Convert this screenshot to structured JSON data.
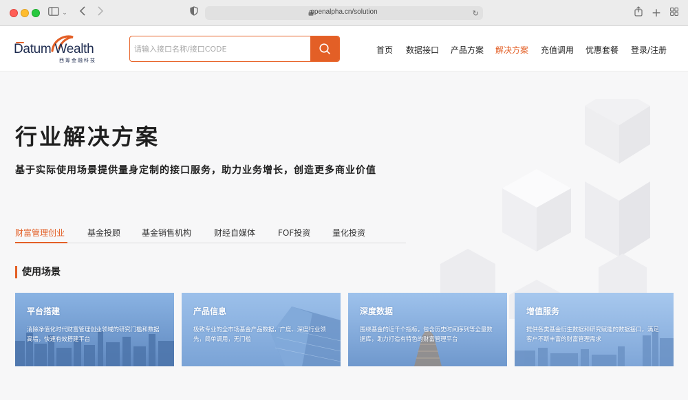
{
  "browser": {
    "url": "openalpha.cn/solution"
  },
  "site": {
    "logo": {
      "word": "Datum Wealth",
      "sub": "西筹金融科技"
    },
    "search": {
      "placeholder": "请输入接口名称/接口CODE",
      "value": ""
    },
    "nav": [
      {
        "label": "首页",
        "active": false
      },
      {
        "label": "数据接口",
        "active": false
      },
      {
        "label": "产品方案",
        "active": false
      },
      {
        "label": "解决方案",
        "active": true
      },
      {
        "label": "充值调用",
        "active": false
      },
      {
        "label": "优惠套餐",
        "active": false
      },
      {
        "label": "登录/注册",
        "active": false
      }
    ]
  },
  "page": {
    "title": "行业解决方案",
    "subtitle": "基于实际使用场景提供量身定制的接口服务，助力业务增长，创造更多商业价值",
    "tabs": [
      {
        "label": "财富管理创业",
        "active": true
      },
      {
        "label": "基金投顾",
        "active": false
      },
      {
        "label": "基金销售机构",
        "active": false
      },
      {
        "label": "财经自媒体",
        "active": false
      },
      {
        "label": "FOF投资",
        "active": false
      },
      {
        "label": "量化投资",
        "active": false
      }
    ],
    "section_title": "使用场景",
    "cards": [
      {
        "title": "平台搭建",
        "desc": "消除净值化时代财富管理创业领域的研究门槛和数据高墙，快速有效搭建平台"
      },
      {
        "title": "产品信息",
        "desc": "极致专业的全市场基金产品数据，广度、深度行业领先，简单调用，无门槛"
      },
      {
        "title": "深度数据",
        "desc": "围绕基金的近千个指标，包含历史时间序列等全量数据库，助力打造有特色的财富管理平台"
      },
      {
        "title": "增值服务",
        "desc": "提供各类基金衍生数据和研究赋能的数据接口，满足客户不断丰富的财富管理需求"
      }
    ]
  },
  "colors": {
    "accent": "#e35f26",
    "card_sky": "#8fb8e6"
  }
}
